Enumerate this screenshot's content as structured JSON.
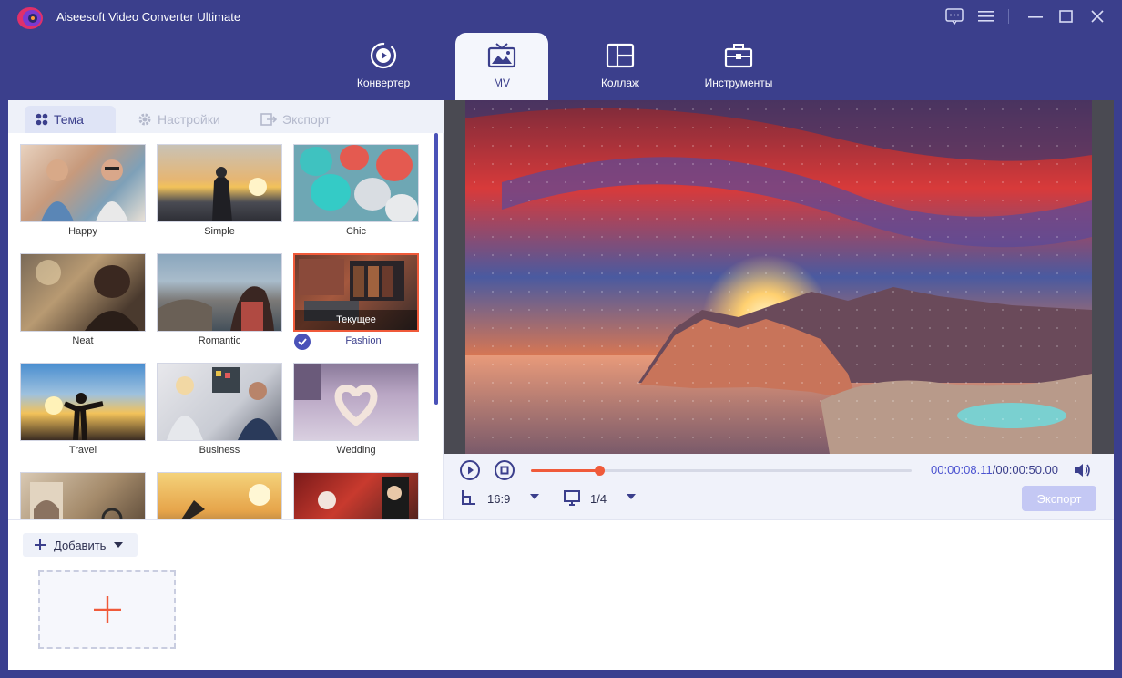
{
  "app": {
    "title": "Aiseesoft Video Converter Ultimate"
  },
  "nav": {
    "tabs": [
      {
        "label": "Конвертер",
        "icon": "convert-icon"
      },
      {
        "label": "MV",
        "icon": "tv-icon",
        "active": true
      },
      {
        "label": "Коллаж",
        "icon": "collage-icon"
      },
      {
        "label": "Инструменты",
        "icon": "toolbox-icon"
      }
    ]
  },
  "subtabs": [
    {
      "label": "Тема",
      "icon": "grid-icon",
      "active": true
    },
    {
      "label": "Настройки",
      "icon": "gear-icon"
    },
    {
      "label": "Экспорт",
      "icon": "export-icon"
    }
  ],
  "themes": [
    {
      "label": "Happy"
    },
    {
      "label": "Simple"
    },
    {
      "label": "Chic"
    },
    {
      "label": "Neat"
    },
    {
      "label": "Romantic"
    },
    {
      "label": "Fashion",
      "current": true,
      "current_caption": "Текущее"
    },
    {
      "label": "Travel"
    },
    {
      "label": "Business"
    },
    {
      "label": "Wedding"
    },
    {
      "label": ""
    },
    {
      "label": ""
    },
    {
      "label": ""
    }
  ],
  "player": {
    "current_time": "00:00:08.11",
    "total_time": "/00:00:50.00",
    "progress": 0.18,
    "aspect_ratio": "16:9",
    "screen_option": "1/4",
    "export_label": "Экспорт"
  },
  "bottom": {
    "add_label": "Добавить"
  },
  "colors": {
    "accent": "#3b3f8c",
    "orange": "#f05a3a"
  }
}
